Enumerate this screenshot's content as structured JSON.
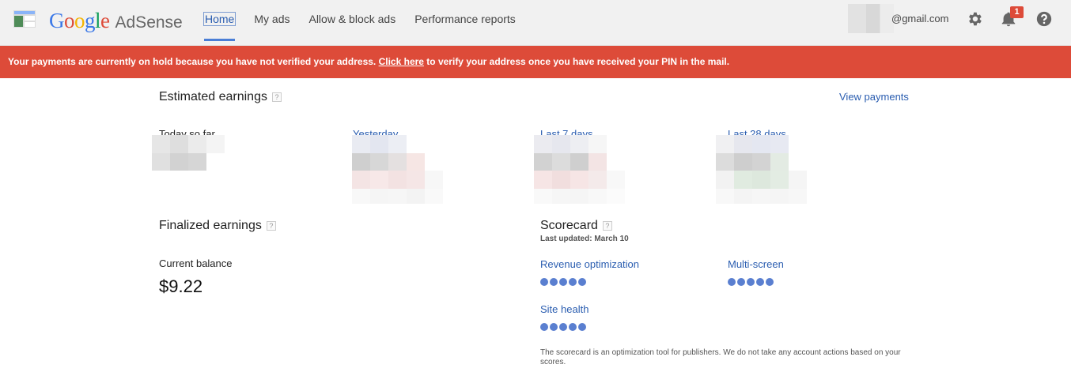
{
  "header": {
    "logo_google": "Google",
    "logo_product": "AdSense",
    "nav": [
      "Home",
      "My ads",
      "Allow & block ads",
      "Performance reports"
    ],
    "email_suffix": "@gmail.com",
    "notification_count": "1"
  },
  "alert": {
    "text_before": "Your payments are currently on hold because you have not verified your address. ",
    "link": "Click here",
    "text_after": " to verify your address once you have received your PIN in the mail."
  },
  "earnings": {
    "title": "Estimated earnings",
    "help": "?",
    "view_payments": "View payments",
    "periods": [
      "Today so far",
      "Yesterday",
      "Last 7 days",
      "Last 28 days"
    ]
  },
  "finalized": {
    "title": "Finalized earnings",
    "help": "?",
    "balance_label": "Current balance",
    "balance_value": "$9.22"
  },
  "scorecard": {
    "title": "Scorecard",
    "help": "?",
    "updated": "Last updated: March 10",
    "items": [
      "Revenue optimization",
      "Multi-screen",
      "Site health"
    ],
    "footnote": "The scorecard is an optimization tool for publishers. We do not take any account actions based on your scores."
  },
  "colors": {
    "alert": "#dd4b39",
    "link": "#2a5db0",
    "dots": "#5a7fd0"
  }
}
